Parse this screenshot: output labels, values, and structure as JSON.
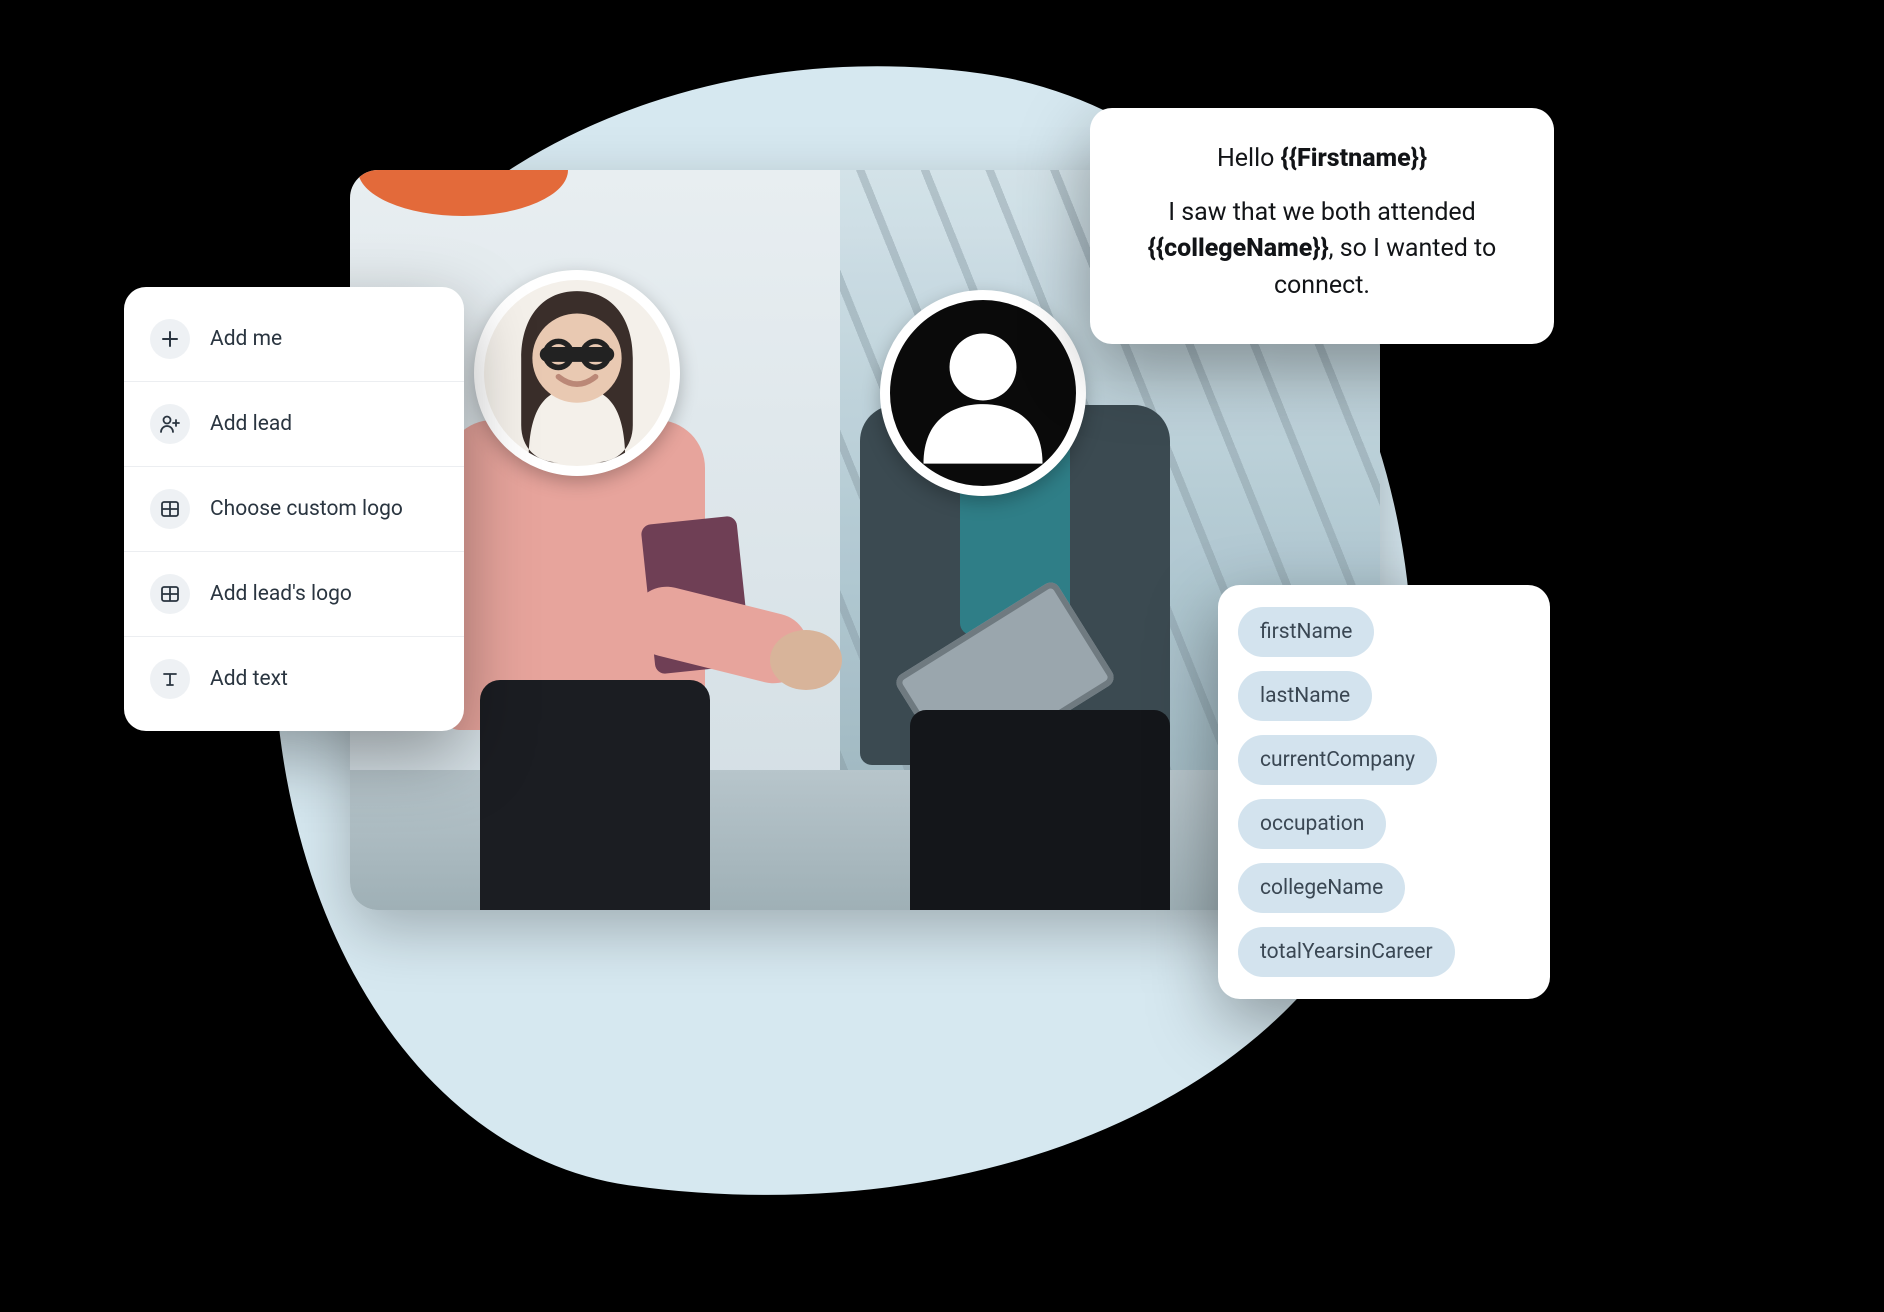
{
  "menu": {
    "items": [
      {
        "icon": "plus-icon",
        "label": "Add me"
      },
      {
        "icon": "person-plus-icon",
        "label": "Add lead"
      },
      {
        "icon": "grid-icon",
        "label": "Choose custom logo"
      },
      {
        "icon": "grid-icon",
        "label": "Add lead's logo"
      },
      {
        "icon": "text-icon",
        "label": "Add text"
      }
    ]
  },
  "message": {
    "hello_prefix": "Hello ",
    "hello_var": "{{Firstname}}",
    "body_before": "I saw that we both attended ",
    "body_var": "{{collegeName}}",
    "body_after": ", so I wanted to connect."
  },
  "vars": [
    "firstName",
    "lastName",
    "currentCompany",
    "occupation",
    "collegeName",
    "totalYearsinCareer"
  ]
}
